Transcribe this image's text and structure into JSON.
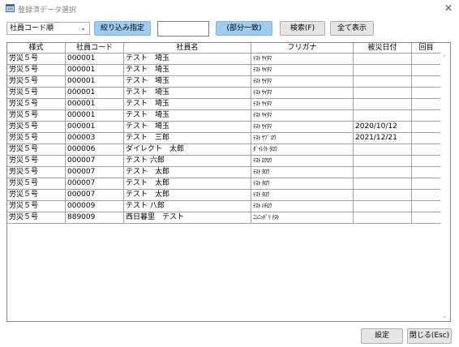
{
  "window": {
    "title": "登録済データ選択",
    "close_glyph": "✕"
  },
  "toolbar": {
    "sort_select": "社員コード順",
    "filter_button": "絞り込み指定",
    "search_value": "",
    "partial_match_button": "(部分一致)",
    "search_button": "検索(F)",
    "show_all_button": "全て表示"
  },
  "table": {
    "columns": [
      "様式",
      "社員コード",
      "社員名",
      "フリガナ",
      "被災日付",
      "回目"
    ],
    "rows": [
      [
        "労災５号",
        "000001",
        "テスト　埼玉",
        "ﾃｽﾄ ｻｲﾀﾏ",
        "",
        ""
      ],
      [
        "労災５号",
        "000001",
        "テスト　埼玉",
        "ﾃｽﾄ ｻｲﾀﾏ",
        "",
        ""
      ],
      [
        "労災５号",
        "000001",
        "テスト　埼玉",
        "ﾃｽﾄ ｻｲﾀﾏ",
        "",
        ""
      ],
      [
        "労災５号",
        "000001",
        "テスト　埼玉",
        "ﾃｽﾄ ｻｲﾀﾏ",
        "",
        ""
      ],
      [
        "労災５号",
        "000001",
        "テスト　埼玉",
        "ﾃｽﾄ ｻｲﾀﾏ",
        "",
        ""
      ],
      [
        "労災５号",
        "000001",
        "テスト　埼玉",
        "ﾃｽﾄ ｻｲﾀﾏ",
        "",
        ""
      ],
      [
        "労災５号",
        "000001",
        "テスト　埼玉",
        "ﾃｽﾄ ｻｲﾀﾏ",
        "2020/10/12",
        ""
      ],
      [
        "労災５号",
        "000003",
        "テスト　三郎",
        "ﾃｽﾄ ｻﾌﾞ ﾛｳ",
        "2021/12/21",
        ""
      ],
      [
        "労災５号",
        "000006",
        "ダイレクト　太郎",
        "ﾀﾞｲﾚｸﾄ ﾀﾛｳ",
        "",
        ""
      ],
      [
        "労災５号",
        "000007",
        "テスト 六郎",
        "ﾃｽﾄ ﾛｸﾛｳ",
        "",
        ""
      ],
      [
        "労災５号",
        "000007",
        "テスト　太郎",
        "ﾃｽﾄ ﾀﾛｳ",
        "",
        ""
      ],
      [
        "労災５号",
        "000007",
        "テスト　太郎",
        "ﾃｽﾄ ﾀﾛｳ",
        "",
        ""
      ],
      [
        "労災５号",
        "000007",
        "テスト　太郎",
        "ﾃｽﾄ ﾀﾛｳ",
        "",
        ""
      ],
      [
        "労災５号",
        "000009",
        "テスト 八郎",
        "ﾃｽﾄ ﾊﾁﾛｳ",
        "",
        ""
      ],
      [
        "労災５号",
        "889009",
        "西日暮里　テスト",
        "ﾆｼﾆｯﾎﾟﾘ ﾃｽﾄ",
        "",
        ""
      ]
    ]
  },
  "footer": {
    "ok_button": "設定",
    "close_button": "閉じる(Esc)"
  },
  "icons": {
    "app": "form-icon",
    "close": "close-icon",
    "chevron": "chevron-down-icon"
  },
  "colors": {
    "accent_button": "#9ecbf0",
    "button": "#e5e5e5"
  }
}
